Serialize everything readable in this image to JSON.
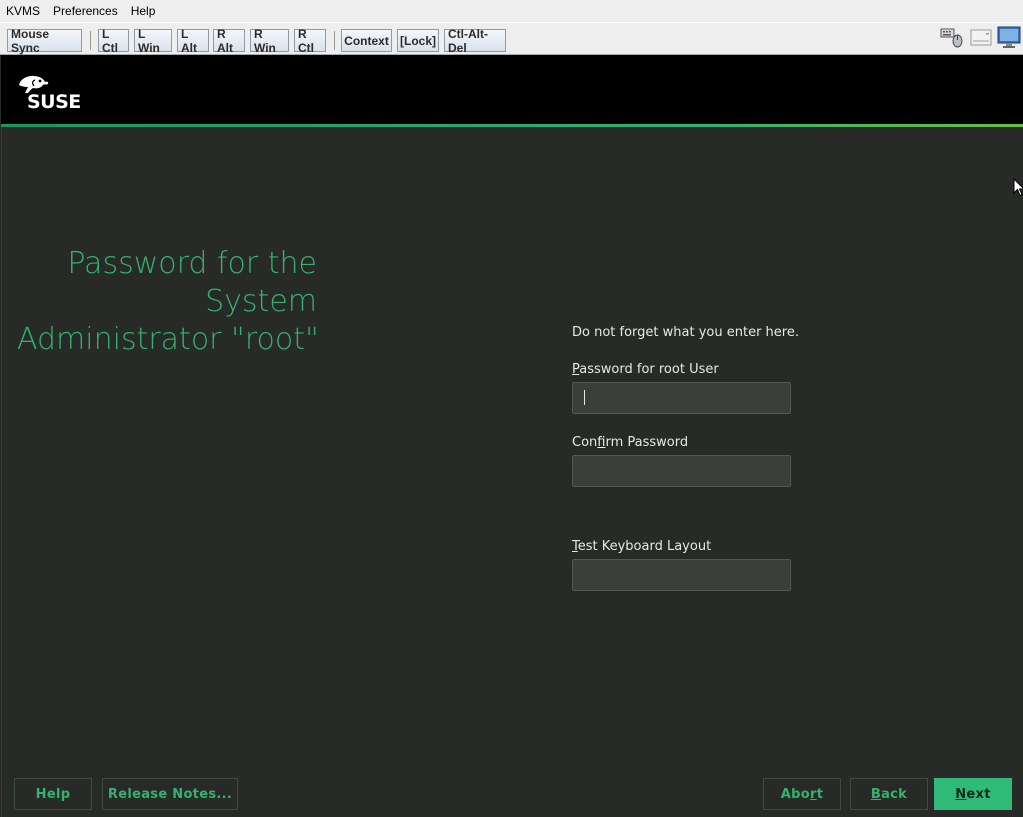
{
  "kvm": {
    "menu": [
      "KVMS",
      "Preferences",
      "Help"
    ],
    "keys": {
      "mouse_sync": "Mouse Sync",
      "l_ctl": "L Ctl",
      "l_win": "L Win",
      "l_alt": "L Alt",
      "r_alt": "R Alt",
      "r_win": "R Win",
      "r_ctl": "R Ctl",
      "context": "Context",
      "lock": "[Lock]",
      "ctl_alt_del": "Ctl-Alt-Del"
    },
    "status_icons": [
      "keyboard-mouse-icon",
      "drive-icon",
      "monitor-icon"
    ]
  },
  "installer": {
    "brand": "SUSE",
    "title_lines": [
      "Password for the",
      "System",
      "Administrator \"root\""
    ],
    "hint": "Do not forget what you enter here.",
    "fields": {
      "password": {
        "label_mnemonic": "P",
        "label_rest": "assword for root User",
        "value": ""
      },
      "confirm": {
        "label_pre": "Con",
        "label_mnemonic": "f",
        "label_rest": "irm Password",
        "value": ""
      },
      "keyboard_test": {
        "label_mnemonic": "T",
        "label_rest": "est Keyboard Layout",
        "value": ""
      }
    },
    "buttons": {
      "help": "Help",
      "release_notes": "Release Notes...",
      "abort_pre": "Abo",
      "abort_mnemonic": "r",
      "abort_rest": "t",
      "back_mnemonic": "B",
      "back_rest": "ack",
      "next_mnemonic": "N",
      "next_rest": "ext"
    },
    "colors": {
      "accent": "#35b26e",
      "background": "#272a27",
      "primary_button": "#30ba78"
    }
  }
}
